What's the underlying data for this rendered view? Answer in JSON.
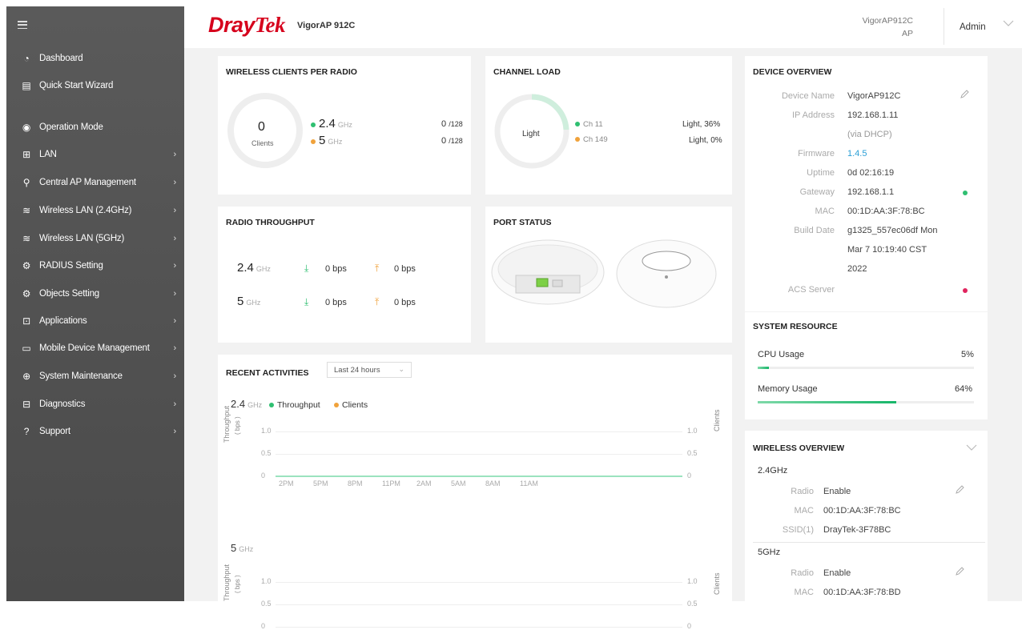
{
  "header": {
    "brand_part1": "Dray",
    "brand_part2": "Tek",
    "model": "VigorAP 912C",
    "device_line1": "VigorAP912C",
    "device_line2": "AP",
    "user": "Admin"
  },
  "sidebar": {
    "items": [
      {
        "label": "Dashboard",
        "icon": "dashboard-icon",
        "chevron": false
      },
      {
        "label": "Quick Start Wizard",
        "icon": "wizard-icon",
        "chevron": false
      },
      {
        "label": "Operation Mode",
        "icon": "operation-mode-icon",
        "chevron": false
      },
      {
        "label": "LAN",
        "icon": "lan-icon",
        "chevron": true
      },
      {
        "label": "Central AP Management",
        "icon": "central-ap-icon",
        "chevron": true
      },
      {
        "label": "Wireless LAN (2.4GHz)",
        "icon": "wifi-icon",
        "chevron": true
      },
      {
        "label": "Wireless LAN (5GHz)",
        "icon": "wifi-icon",
        "chevron": true
      },
      {
        "label": "RADIUS Setting",
        "icon": "gear-icon",
        "chevron": true
      },
      {
        "label": "Objects Setting",
        "icon": "gear-icon",
        "chevron": true
      },
      {
        "label": "Applications",
        "icon": "applications-icon",
        "chevron": true
      },
      {
        "label": "Mobile Device Management",
        "icon": "mobile-icon",
        "chevron": true
      },
      {
        "label": "System Maintenance",
        "icon": "maintenance-icon",
        "chevron": true
      },
      {
        "label": "Diagnostics",
        "icon": "diagnostics-icon",
        "chevron": true
      },
      {
        "label": "Support",
        "icon": "support-icon",
        "chevron": true
      }
    ]
  },
  "clients": {
    "title": "WIRELESS CLIENTS PER RADIO",
    "count": "0",
    "count_label": "Clients",
    "band1": "2.4",
    "band2": "5",
    "unit": "GHz",
    "band1_value": "0",
    "band1_max": "/128",
    "band2_value": "0",
    "band2_max": "/128"
  },
  "channel": {
    "title": "CHANNEL LOAD",
    "center": "Light",
    "ch1": "Ch 11",
    "ch1_value": "Light, 36%",
    "ch2": "Ch 149",
    "ch2_value": "Light, 0%"
  },
  "throughput": {
    "title": "RADIO THROUGHPUT",
    "band1": "2.4",
    "band2": "5",
    "unit": "GHz",
    "b1_down": "0 bps",
    "b1_up": "0 bps",
    "b2_down": "0 bps",
    "b2_up": "0 bps"
  },
  "port_status": {
    "title": "PORT STATUS"
  },
  "activities": {
    "title": "RECENT ACTIVITIES",
    "range": "Last 24 hours",
    "band1": "2.4",
    "band2": "5",
    "unit": "GHz",
    "legend_throughput": "Throughput",
    "legend_clients": "Clients",
    "y_left": "Throughput",
    "y_left_unit": "( bps )",
    "y_right": "Clients",
    "ticks_y": [
      "1.0",
      "0.5",
      "0"
    ],
    "ticks_x": [
      "2PM",
      "5PM",
      "8PM",
      "11PM",
      "2AM",
      "5AM",
      "8AM",
      "11AM"
    ]
  },
  "chart_data": [
    {
      "type": "line",
      "title": "2.4 GHz",
      "x": [
        "2PM",
        "5PM",
        "8PM",
        "11PM",
        "2AM",
        "5AM",
        "8AM",
        "11AM"
      ],
      "series": [
        {
          "name": "Throughput",
          "values": [
            0,
            0,
            0,
            0,
            0,
            0,
            0,
            0
          ]
        },
        {
          "name": "Clients",
          "values": [
            0,
            0,
            0,
            0,
            0,
            0,
            0,
            0
          ]
        }
      ],
      "ylabel": "Throughput ( bps )",
      "ylabel_right": "Clients",
      "ylim": [
        0,
        1.0
      ]
    }
  ],
  "device": {
    "title": "DEVICE OVERVIEW",
    "device_name_k": "Device Name",
    "device_name_v": "VigorAP912C",
    "ip_k": "IP Address",
    "ip_v": "192.168.1.11",
    "ip_note": "(via DHCP)",
    "fw_k": "Firmware",
    "fw_v": "1.4.5",
    "uptime_k": "Uptime",
    "uptime_v": "0d 02:16:19",
    "gw_k": "Gateway",
    "gw_v": "192.168.1.1",
    "mac_k": "MAC",
    "mac_v": "00:1D:AA:3F:78:BC",
    "build_k": "Build Date",
    "build_v1": "g1325_557ec06df Mon",
    "build_v2": "Mar 7 10:19:40 CST",
    "build_v3": "2022",
    "acs_k": "ACS Server"
  },
  "resource": {
    "title": "SYSTEM RESOURCE",
    "cpu_label": "CPU Usage",
    "cpu_value": "5%",
    "cpu_fraction": 0.05,
    "mem_label": "Memory Usage",
    "mem_value": "64%",
    "mem_fraction": 0.64
  },
  "wireless": {
    "title": "WIRELESS OVERVIEW",
    "b1": "2.4GHz",
    "b1_radio_k": "Radio",
    "b1_radio_v": "Enable",
    "b1_mac_k": "MAC",
    "b1_mac_v": "00:1D:AA:3F:78:BC",
    "b1_ssid_k": "SSID(1)",
    "b1_ssid_v": "DrayTek-3F78BC",
    "b2": "5GHz",
    "b2_radio_k": "Radio",
    "b2_radio_v": "Enable",
    "b2_mac_k": "MAC",
    "b2_mac_v": "00:1D:AA:3F:78:BD"
  },
  "colors": {
    "green": "#2fbf71",
    "orange": "#f0a23b",
    "red": "#e0245e",
    "blue": "#2a9fd6"
  }
}
